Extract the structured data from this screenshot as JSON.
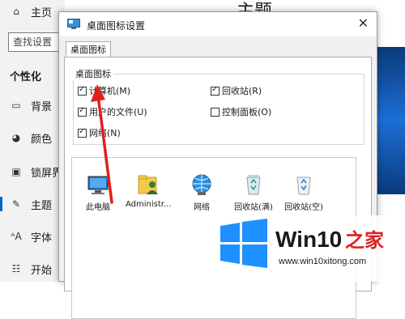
{
  "settings": {
    "nav": [
      {
        "label": "主页",
        "icon": "home-icon"
      },
      {
        "label": "背景",
        "icon": "picture-icon"
      },
      {
        "label": "颜色",
        "icon": "palette-icon"
      },
      {
        "label": "锁屏界",
        "icon": "lock-screen-icon"
      },
      {
        "label": "主题",
        "icon": "brush-icon"
      },
      {
        "label": "字体",
        "icon": "font-icon"
      },
      {
        "label": "开始",
        "icon": "start-icon"
      }
    ],
    "search_text": "查找设置",
    "section_title": "个性化",
    "page_title": "主题",
    "accent_color": "#0067c0"
  },
  "dialog": {
    "title": "桌面图标设置",
    "tab": "桌面图标",
    "group_label": "桌面图标",
    "checkboxes": [
      {
        "label": "计算机(M)",
        "checked": true
      },
      {
        "label": "回收站(R)",
        "checked": true
      },
      {
        "label": "用户的文件(U)",
        "checked": true
      },
      {
        "label": "控制面板(O)",
        "checked": false
      },
      {
        "label": "网络(N)",
        "checked": true
      }
    ],
    "icons": [
      {
        "label": "此电脑",
        "icon": "computer-icon"
      },
      {
        "label": "Administr...",
        "icon": "user-folder-icon"
      },
      {
        "label": "网络",
        "icon": "network-icon"
      },
      {
        "label": "回收站(满)",
        "icon": "recycle-bin-full-icon"
      },
      {
        "label": "回收站(空)",
        "icon": "recycle-bin-empty-icon"
      }
    ]
  },
  "annotation_color": "#e0201c",
  "watermark": {
    "title": "Win10",
    "title_accent": "之家",
    "url": "www.win10xitong.com"
  }
}
